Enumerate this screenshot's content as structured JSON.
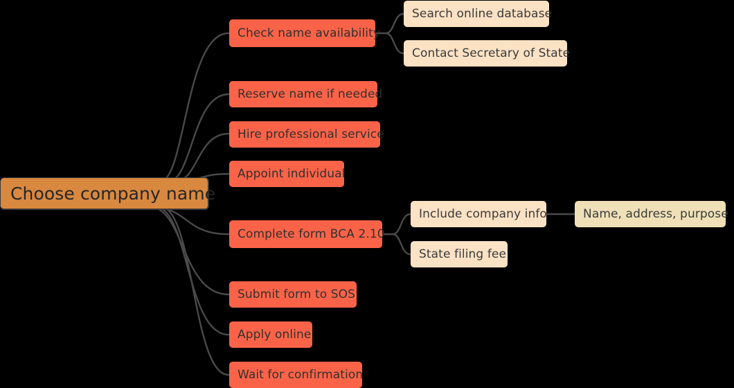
{
  "diagram": {
    "type": "mind-map",
    "title": "Choose company name",
    "background_color": "#000000",
    "colors": {
      "root_fill": "#D9883F",
      "level1_fill": "#FB6348",
      "level2_fill": "#FCE2C4",
      "level3_fill": "#EFE0B7",
      "connector": "#4a4a4a",
      "text": "#333333"
    },
    "root": {
      "label": "Choose company name"
    },
    "branches": [
      {
        "id": "check-name-availability",
        "label": "Check name availability",
        "children": [
          {
            "id": "search-online-database",
            "label": "Search online database",
            "children": []
          },
          {
            "id": "contact-secretary-of-state",
            "label": "Contact Secretary of State",
            "children": []
          }
        ]
      },
      {
        "id": "reserve-name-if-needed",
        "label": "Reserve name if needed",
        "children": []
      },
      {
        "id": "hire-professional-service",
        "label": "Hire professional service",
        "children": []
      },
      {
        "id": "appoint-individual",
        "label": "Appoint individual",
        "children": []
      },
      {
        "id": "complete-form-bca-210",
        "label": "Complete form BCA 2.10",
        "children": [
          {
            "id": "include-company-info",
            "label": "Include company info",
            "children": [
              {
                "id": "name-address-purpose",
                "label": "Name, address, purpose",
                "children": []
              }
            ]
          },
          {
            "id": "state-filing-fee",
            "label": "State filing fee",
            "children": []
          }
        ]
      },
      {
        "id": "submit-form-to-sos",
        "label": "Submit form to SOS",
        "children": []
      },
      {
        "id": "apply-online",
        "label": "Apply online",
        "children": []
      },
      {
        "id": "wait-for-confirmation",
        "label": "Wait for confirmation",
        "children": []
      }
    ]
  }
}
